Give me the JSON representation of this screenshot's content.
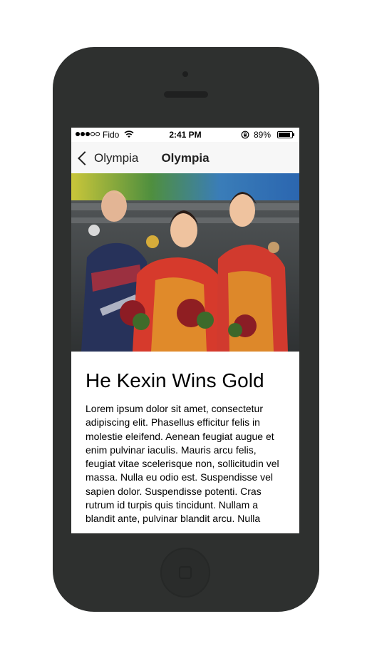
{
  "status_bar": {
    "carrier": "Fido",
    "time": "2:41 PM",
    "battery": "89%",
    "signal_bars_filled": 3,
    "signal_bars_total": 5
  },
  "nav": {
    "back_label": "Olympia",
    "title": "Olympia"
  },
  "article": {
    "headline": "He Kexin Wins Gold",
    "body": "Lorem ipsum dolor sit amet, consectetur adipiscing elit. Phasellus efficitur felis in molestie eleifend. Aenean feugiat augue et enim pulvinar iaculis. Mauris arcu felis, feugiat vitae scelerisque non, sollicitudin vel massa. Nulla eu odio est. Suspendisse vel sapien dolor. Suspendisse potenti. Cras rutrum id turpis quis tincidunt. Nullam a blandit ante, pulvinar blandit arcu. Nulla"
  },
  "icons": {
    "back": "chevron-left-icon",
    "wifi": "wifi-icon",
    "orientation_lock": "orientation-lock-icon",
    "battery": "battery-icon",
    "home": "home-button-icon"
  },
  "colors": {
    "device_body": "#2e302f",
    "nav_bar": "#f7f7f7",
    "text": "#000000"
  }
}
